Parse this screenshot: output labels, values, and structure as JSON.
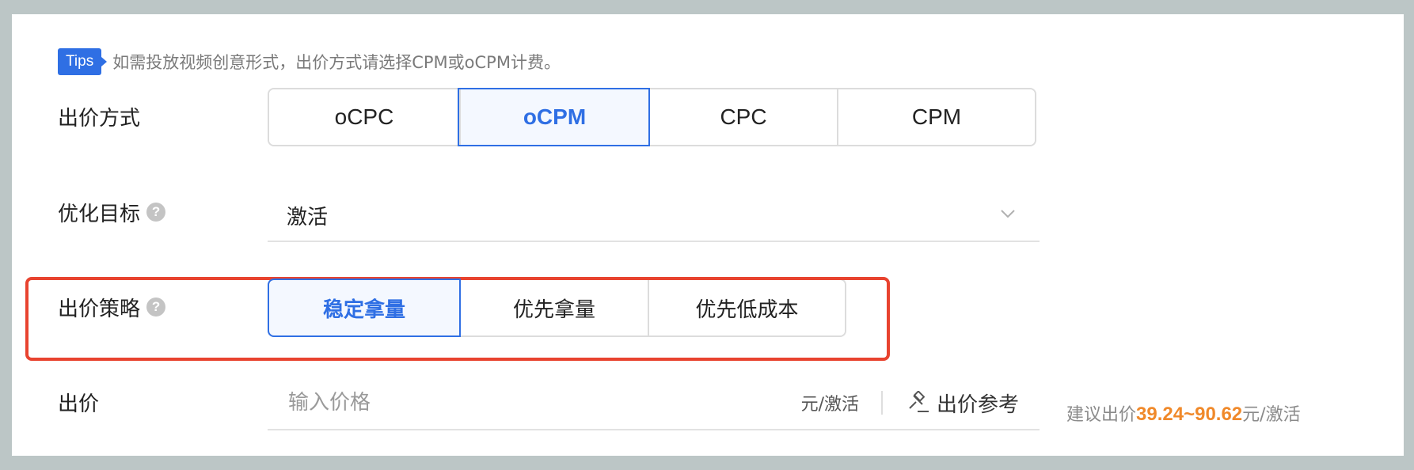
{
  "tips": {
    "badge": "Tips",
    "text": "如需投放视频创意形式，出价方式请选择CPM或oCPM计费。"
  },
  "bid_method": {
    "label": "出价方式",
    "options": [
      "oCPC",
      "oCPM",
      "CPC",
      "CPM"
    ],
    "selected": "oCPM"
  },
  "optimization_goal": {
    "label": "优化目标",
    "help_icon": "question-circle-icon",
    "value": "激活",
    "dropdown_icon": "chevron-down-icon"
  },
  "bid_strategy": {
    "label": "出价策略",
    "help_icon": "question-circle-icon",
    "options": [
      "稳定拿量",
      "优先拿量",
      "优先低成本"
    ],
    "selected": "稳定拿量"
  },
  "bid": {
    "label": "出价",
    "placeholder": "输入价格",
    "unit": "元/激活",
    "reference_label": "出价参考",
    "reference_icon": "gavel-icon",
    "suggest_prefix": "建议出价",
    "suggest_range": "39.24~90.62",
    "suggest_suffix": "元/激活"
  },
  "colors": {
    "accent": "#2f6fe4",
    "highlight": "#e8432f",
    "suggest": "#f0892a",
    "outer_bg": "#bcc6c6"
  }
}
